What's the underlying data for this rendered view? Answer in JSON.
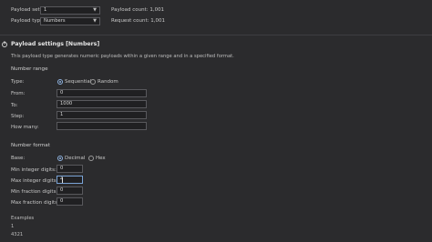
{
  "payload_sets": {
    "set_label": "Payload set:",
    "set_value": "1",
    "type_label": "Payload type:",
    "type_value": "Numbers",
    "payload_count": "Payload count:  1,001",
    "request_count": "Request count:  1,001"
  },
  "settings": {
    "title": "Payload settings [Numbers]",
    "description": "This payload type generates numeric payloads within a given range and in a specified format.",
    "number_range": {
      "heading": "Number range",
      "type_label": "Type:",
      "sequential": "Sequential",
      "random": "Random",
      "from_label": "From:",
      "from_value": "0",
      "to_label": "To:",
      "to_value": "1000",
      "step_label": "Step:",
      "step_value": "1",
      "how_many_label": "How many:",
      "how_many_value": ""
    },
    "number_format": {
      "heading": "Number format",
      "base_label": "Base:",
      "decimal": "Decimal",
      "hex": "Hex",
      "min_int_label": "Min integer digits:",
      "min_int_value": "0",
      "max_int_label": "Max integer digits:",
      "max_int_value": "4",
      "min_frac_label": "Min fraction digits:",
      "min_frac_value": "0",
      "max_frac_label": "Max fraction digits:",
      "max_frac_value": "0"
    },
    "examples": {
      "heading": "Examples",
      "example_1": "1",
      "example_2": "4321"
    }
  },
  "colors": {
    "background": "#2b2b2d",
    "input_background": "#202022",
    "accent": "#8fb3e0"
  }
}
